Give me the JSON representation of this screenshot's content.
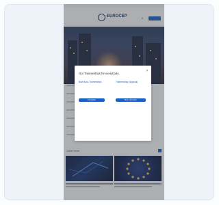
{
  "header": {
    "logo_text": "EUROCEP",
    "search_icon": "magnifier-icon"
  },
  "modal": {
    "title": "Our Traineeships for everybody",
    "close_icon": "close-icon",
    "columns": [
      {
        "heading": "Blue Book Traineeships",
        "button_label": "Information"
      },
      {
        "heading": "Traineeships (Atypical)",
        "button_label": "More information"
      }
    ]
  },
  "news": {
    "section_title": "Latest News"
  },
  "colors": {
    "accent": "#1a5fc4",
    "brand": "#1b3a66"
  }
}
